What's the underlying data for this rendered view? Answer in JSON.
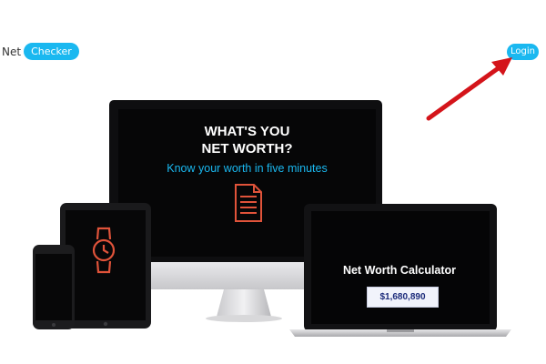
{
  "header": {
    "logo_prefix": "Net",
    "logo_pill": "Checker",
    "login_label": "Login"
  },
  "monitor": {
    "headline_line1": "WHAT'S YOU",
    "headline_line2": "NET WORTH?",
    "subheadline": "Know your worth in five minutes",
    "icon": "document-icon"
  },
  "tablet": {
    "icon": "watch-icon"
  },
  "laptop": {
    "title": "Net Worth Calculator",
    "value": "$1,680,890"
  },
  "colors": {
    "accent": "#1ab8f0",
    "icon_orange": "#e0533a",
    "arrow_red": "#d4141a"
  }
}
